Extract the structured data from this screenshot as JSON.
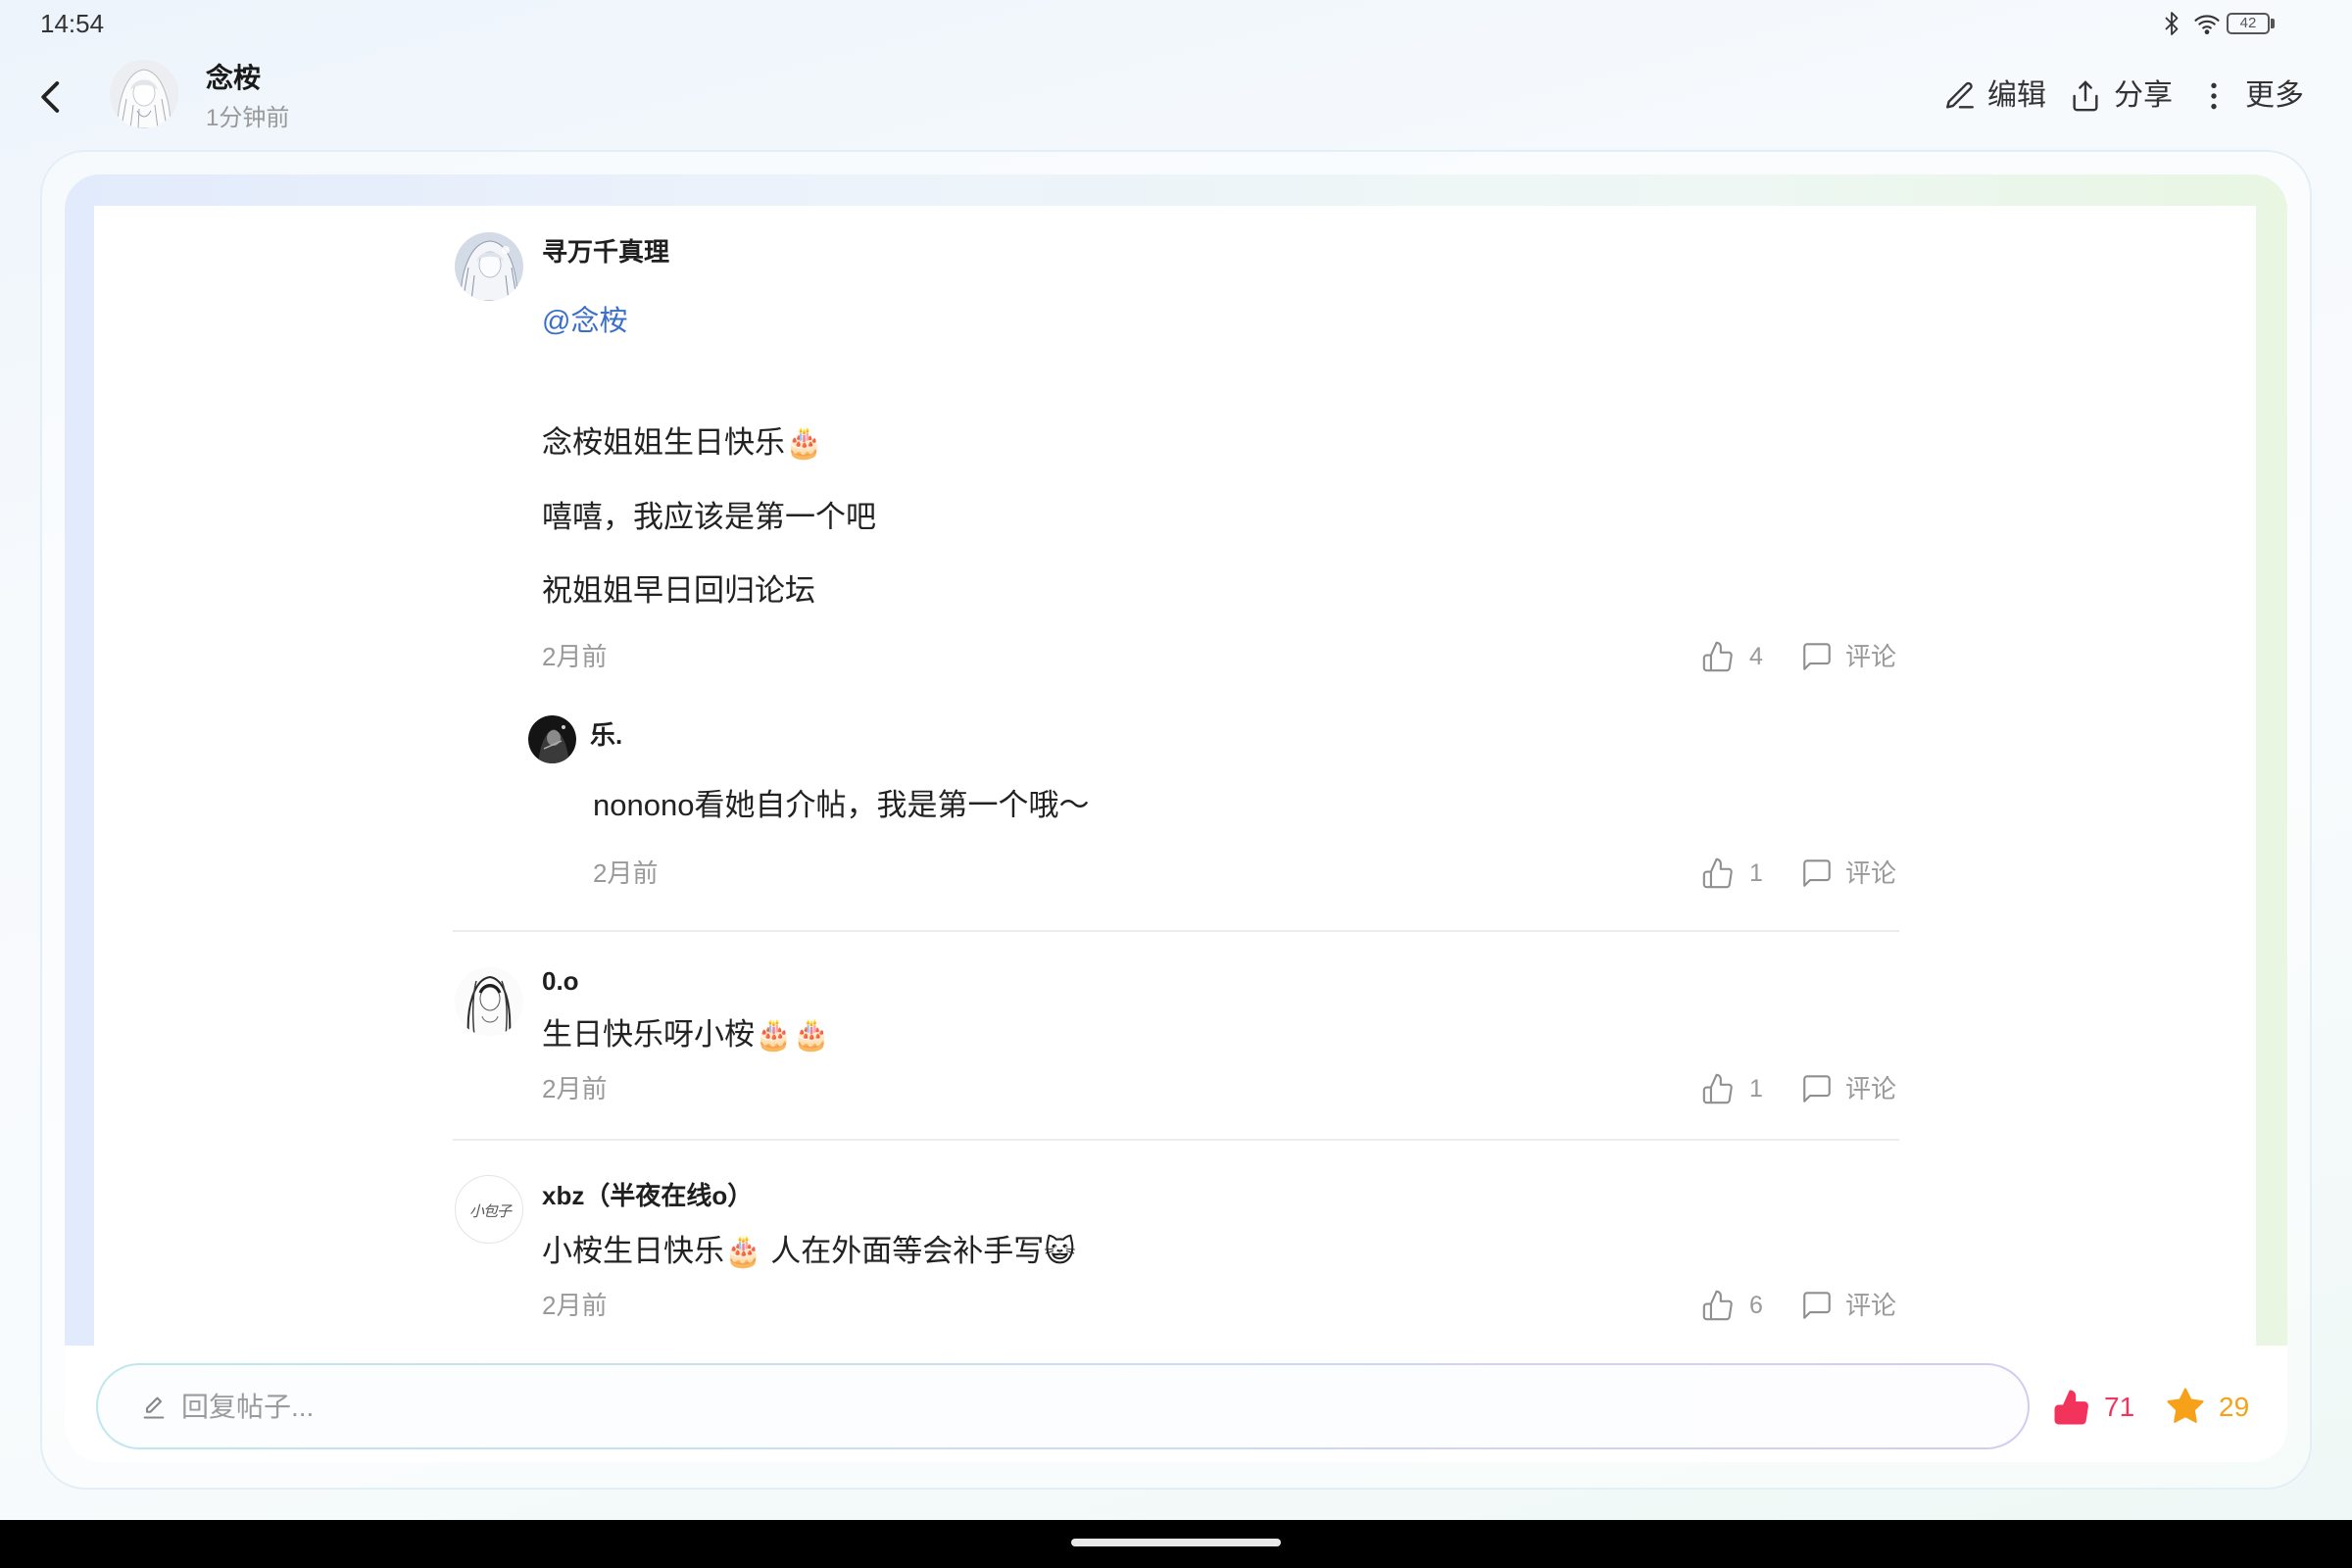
{
  "status_bar": {
    "time": "14:54",
    "battery": "42",
    "icons": [
      "bluetooth-icon",
      "wifi-icon",
      "battery-icon"
    ]
  },
  "header": {
    "back_icon": "chevron-left-icon",
    "title": "念桉",
    "subtitle": "1分钟前",
    "actions": [
      {
        "icon": "edit-icon",
        "label": "编辑"
      },
      {
        "icon": "share-icon",
        "label": "分享"
      },
      {
        "icon": "more-vertical-icon",
        "label": "更多"
      }
    ]
  },
  "comments": [
    {
      "author": "寻万千真理",
      "mention": "@念桉",
      "lines": [
        "念桉姐姐生日快乐🎂",
        "嘻嘻，我应该是第一个吧",
        "祝姐姐早日回归论坛"
      ],
      "time": "2月前",
      "likes": "4",
      "comment_label": "评论",
      "replies": [
        {
          "author": "乐.",
          "text": "nonono看她自介帖，我是第一个哦～",
          "time": "2月前",
          "likes": "1",
          "comment_label": "评论"
        }
      ]
    },
    {
      "author": "0.o",
      "text": "生日快乐呀小桉🎂🎂",
      "time": "2月前",
      "likes": "1",
      "comment_label": "评论"
    },
    {
      "author": "xbz（半夜在线o）",
      "avatar_text": "小包子",
      "text": "小桉生日快乐🎂 人在外面等会补手写😺",
      "time": "2月前",
      "likes": "6",
      "comment_label": "评论"
    }
  ],
  "comment_action_icons": {
    "like": "thumbs-up-icon",
    "comment": "comment-icon"
  },
  "reply_bar": {
    "input_icon": "pencil-icon",
    "placeholder": "回复帖子...",
    "likes": "71",
    "liked": true,
    "like_icon": "thumbs-up-filled-icon",
    "favorites": "29",
    "favorited": true,
    "favorite_icon": "star-filled-icon"
  },
  "colors": {
    "text": "#222222",
    "muted": "#999999",
    "mention": "#3a6fc8",
    "like_active": "#f2335c",
    "favorite": "#f7a11a",
    "nav_bar": "#000000"
  }
}
